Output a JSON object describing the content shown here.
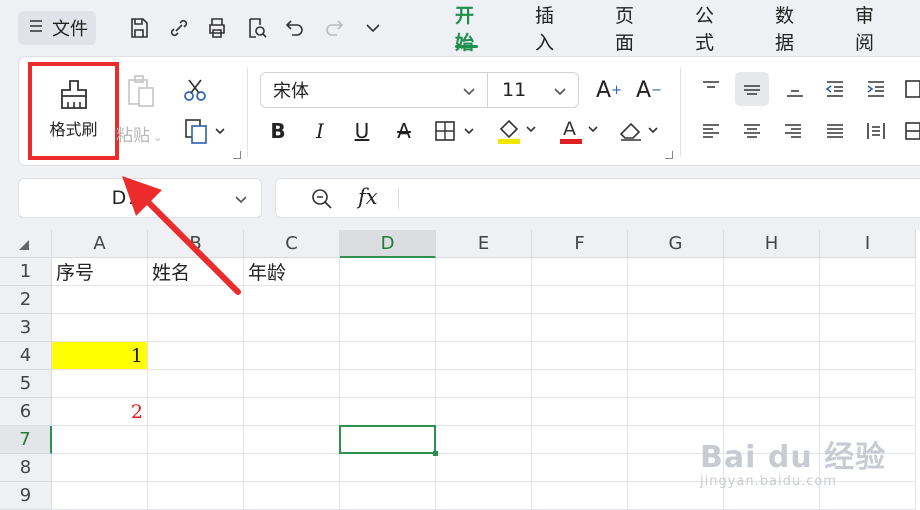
{
  "toolbar": {
    "file_label": "文件",
    "quick_access": [
      "save-icon",
      "link-icon",
      "print-icon",
      "print-preview-icon",
      "undo-icon",
      "redo-icon",
      "more-chevron-icon"
    ],
    "tabs": [
      {
        "label": "开始",
        "active": true
      },
      {
        "label": "插入",
        "active": false
      },
      {
        "label": "页面",
        "active": false
      },
      {
        "label": "公式",
        "active": false
      },
      {
        "label": "数据",
        "active": false
      },
      {
        "label": "审阅",
        "active": false
      }
    ]
  },
  "ribbon": {
    "format_painter_label": "格式刷",
    "paste_label": "粘贴",
    "font_name": "宋体",
    "font_size": "11",
    "highlight_color": "#f2e600",
    "font_color": "#e02020"
  },
  "formula": {
    "name_box": "D7",
    "fx_label": "fx",
    "content": ""
  },
  "sheet": {
    "columns": [
      "A",
      "B",
      "C",
      "D",
      "E",
      "F",
      "G",
      "H",
      "I"
    ],
    "rows": [
      "1",
      "2",
      "3",
      "4",
      "5",
      "6",
      "7",
      "8",
      "9"
    ],
    "selected_column": "D",
    "selected_row": "7",
    "cells": {
      "A1": "序号",
      "B1": "姓名",
      "C1": "年龄",
      "A4": "1",
      "A6": "2"
    },
    "cell_colors": {
      "A4_fill": "#ffff00",
      "A6_text": "#d02020"
    }
  },
  "accent_color": "#1f8f4d",
  "annotation_color": "#ec2c2c",
  "watermark": {
    "main": "Bai du 经验",
    "sub": "jingyan.baidu.com"
  }
}
